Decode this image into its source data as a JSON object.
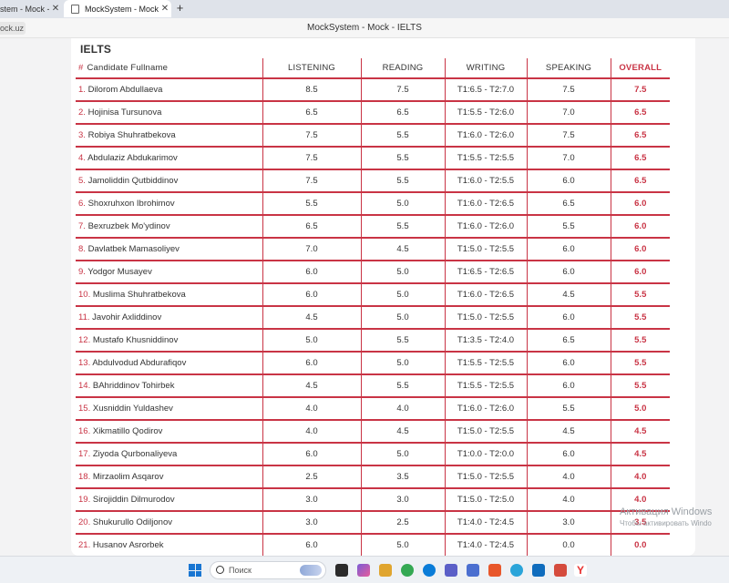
{
  "browser": {
    "tabs": [
      {
        "label": "stem - Mock - Hon",
        "active": false
      },
      {
        "label": "MockSystem - Mock - IE",
        "active": true
      }
    ],
    "address_fragment": "ock.uz",
    "page_title": "MockSystem - Mock - IELTS"
  },
  "section_title": "IELTS",
  "table": {
    "headers": {
      "hash": "#",
      "name": "Candidate Fullname",
      "listening": "LISTENING",
      "reading": "READING",
      "writing": "WRITING",
      "speaking": "SPEAKING",
      "overall": "OVERALL"
    },
    "rows": [
      {
        "num": "1.",
        "name": "Dilorom Abdullaeva",
        "listening": "8.5",
        "reading": "7.5",
        "writing": "T1:6.5 - T2:7.0",
        "speaking": "7.5",
        "overall": "7.5"
      },
      {
        "num": "2.",
        "name": "Hojinisa Tursunova",
        "listening": "6.5",
        "reading": "6.5",
        "writing": "T1:5.5 - T2:6.0",
        "speaking": "7.0",
        "overall": "6.5"
      },
      {
        "num": "3.",
        "name": "Robiya Shuhratbekova",
        "listening": "7.5",
        "reading": "5.5",
        "writing": "T1:6.0 - T2:6.0",
        "speaking": "7.5",
        "overall": "6.5"
      },
      {
        "num": "4.",
        "name": "Abdulaziz Abdukarimov",
        "listening": "7.5",
        "reading": "5.5",
        "writing": "T1:5.5 - T2:5.5",
        "speaking": "7.0",
        "overall": "6.5"
      },
      {
        "num": "5.",
        "name": "Jamoliddin Qutbiddinov",
        "listening": "7.5",
        "reading": "5.5",
        "writing": "T1:6.0 - T2:5.5",
        "speaking": "6.0",
        "overall": "6.5"
      },
      {
        "num": "6.",
        "name": "Shoxruhxon Ibrohimov",
        "listening": "5.5",
        "reading": "5.0",
        "writing": "T1:6.0 - T2:6.5",
        "speaking": "6.5",
        "overall": "6.0"
      },
      {
        "num": "7.",
        "name": "Bexruzbek Mo'ydinov",
        "listening": "6.5",
        "reading": "5.5",
        "writing": "T1:6.0 - T2:6.0",
        "speaking": "5.5",
        "overall": "6.0"
      },
      {
        "num": "8.",
        "name": "Davlatbek Mamasoliyev",
        "listening": "7.0",
        "reading": "4.5",
        "writing": "T1:5.0 - T2:5.5",
        "speaking": "6.0",
        "overall": "6.0"
      },
      {
        "num": "9.",
        "name": "Yodgor Musayev",
        "listening": "6.0",
        "reading": "5.0",
        "writing": "T1:6.5 - T2:6.5",
        "speaking": "6.0",
        "overall": "6.0"
      },
      {
        "num": "10.",
        "name": "Muslima Shuhratbekova",
        "listening": "6.0",
        "reading": "5.0",
        "writing": "T1:6.0 - T2:6.5",
        "speaking": "4.5",
        "overall": "5.5"
      },
      {
        "num": "11.",
        "name": "Javohir Axliddinov",
        "listening": "4.5",
        "reading": "5.0",
        "writing": "T1:5.0 - T2:5.5",
        "speaking": "6.0",
        "overall": "5.5"
      },
      {
        "num": "12.",
        "name": "Mustafo Khusniddinov",
        "listening": "5.0",
        "reading": "5.5",
        "writing": "T1:3.5 - T2:4.0",
        "speaking": "6.5",
        "overall": "5.5"
      },
      {
        "num": "13.",
        "name": "Abdulvodud Abdurafiqov",
        "listening": "6.0",
        "reading": "5.0",
        "writing": "T1:5.5 - T2:5.5",
        "speaking": "6.0",
        "overall": "5.5"
      },
      {
        "num": "14.",
        "name": "BAhriddinov Tohirbek",
        "listening": "4.5",
        "reading": "5.5",
        "writing": "T1:5.5 - T2:5.5",
        "speaking": "6.0",
        "overall": "5.5"
      },
      {
        "num": "15.",
        "name": "Xusniddin Yuldashev",
        "listening": "4.0",
        "reading": "4.0",
        "writing": "T1:6.0 - T2:6.0",
        "speaking": "5.5",
        "overall": "5.0"
      },
      {
        "num": "16.",
        "name": "Xikmatillo Qodirov",
        "listening": "4.0",
        "reading": "4.5",
        "writing": "T1:5.0 - T2:5.5",
        "speaking": "4.5",
        "overall": "4.5"
      },
      {
        "num": "17.",
        "name": "Ziyoda Qurbonaliyeva",
        "listening": "6.0",
        "reading": "5.0",
        "writing": "T1:0.0 - T2:0.0",
        "speaking": "6.0",
        "overall": "4.5"
      },
      {
        "num": "18.",
        "name": "Mirzaolim Asqarov",
        "listening": "2.5",
        "reading": "3.5",
        "writing": "T1:5.0 - T2:5.5",
        "speaking": "4.0",
        "overall": "4.0"
      },
      {
        "num": "19.",
        "name": "Sirojiddin Dilmurodov",
        "listening": "3.0",
        "reading": "3.0",
        "writing": "T1:5.0 - T2:5.0",
        "speaking": "4.0",
        "overall": "4.0"
      },
      {
        "num": "20.",
        "name": "Shukurullo Odiljonov",
        "listening": "3.0",
        "reading": "2.5",
        "writing": "T1:4.0 - T2:4.5",
        "speaking": "3.0",
        "overall": "3.5"
      },
      {
        "num": "21.",
        "name": "Husanov Asrorbek",
        "listening": "6.0",
        "reading": "5.0",
        "writing": "T1:4.0 - T2:4.5",
        "speaking": "0.0",
        "overall": "0.0"
      }
    ]
  },
  "watermark": {
    "line1": "Активация Windows",
    "line2": "Чтобы активировать Windo"
  },
  "taskbar": {
    "search_placeholder": "Поиск"
  },
  "colors": {
    "accent": "#c93445",
    "windows_blue": "#1976d2"
  }
}
